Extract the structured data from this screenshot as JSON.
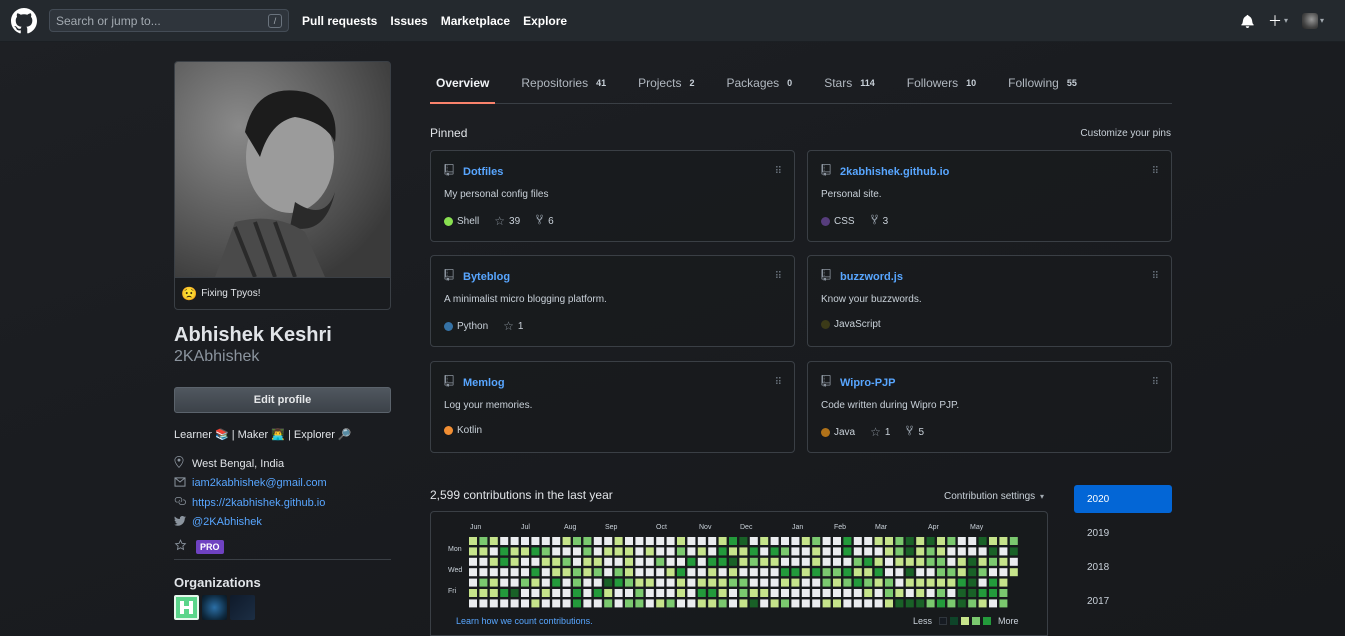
{
  "header": {
    "search_placeholder": "Search or jump to...",
    "search_shortcut": "/",
    "nav": [
      "Pull requests",
      "Issues",
      "Marketplace",
      "Explore"
    ]
  },
  "profile": {
    "status": "Fixing Tpyos!",
    "status_emoji": "😟",
    "fullname": "Abhishek Keshri",
    "username": "2KAbhishek",
    "edit_label": "Edit profile",
    "bio": "Learner 📚 | Maker 👨‍💻 | Explorer 🔎",
    "location": "West Bengal, India",
    "email": "iam2kabhishek@gmail.com",
    "website": "https://2kabhishek.github.io",
    "twitter": "@2KAbhishek",
    "pro_badge": "PRO",
    "orgs_title": "Organizations"
  },
  "tabs": [
    {
      "label": "Overview",
      "count": ""
    },
    {
      "label": "Repositories",
      "count": "41"
    },
    {
      "label": "Projects",
      "count": "2"
    },
    {
      "label": "Packages",
      "count": "0"
    },
    {
      "label": "Stars",
      "count": "114"
    },
    {
      "label": "Followers",
      "count": "10"
    },
    {
      "label": "Following",
      "count": "55"
    }
  ],
  "pinned": {
    "title": "Pinned",
    "customize": "Customize your pins",
    "repos": [
      {
        "name": "Dotfiles",
        "desc": "My personal config files",
        "lang": "Shell",
        "lang_color": "#89e051",
        "stars": "39",
        "forks": "6"
      },
      {
        "name": "2kabhishek.github.io",
        "desc": "Personal site.",
        "lang": "CSS",
        "lang_color": "#563d7c",
        "stars": "",
        "forks": "3"
      },
      {
        "name": "Byteblog",
        "desc": "A minimalist micro blogging platform.",
        "lang": "Python",
        "lang_color": "#3572A5",
        "stars": "1",
        "forks": ""
      },
      {
        "name": "buzzword.js",
        "desc": "Know your buzzwords.",
        "lang": "JavaScript",
        "lang_color": "#3b3a18",
        "stars": "",
        "forks": ""
      },
      {
        "name": "Memlog",
        "desc": "Log your memories.",
        "lang": "Kotlin",
        "lang_color": "#F18E33",
        "stars": "",
        "forks": ""
      },
      {
        "name": "Wipro-PJP",
        "desc": "Code written during Wipro PJP.",
        "lang": "Java",
        "lang_color": "#b07219",
        "stars": "1",
        "forks": "5"
      }
    ]
  },
  "contributions": {
    "title": "2,599 contributions in the last year",
    "settings": "Contribution settings",
    "months": [
      "Jun",
      "Jul",
      "Aug",
      "Sep",
      "Oct",
      "Nov",
      "Dec",
      "Jan",
      "Feb",
      "Mar",
      "Apr",
      "May"
    ],
    "days": [
      "Mon",
      "Wed",
      "Fri"
    ],
    "learn": "Learn how we count contributions.",
    "less": "Less",
    "more": "More",
    "colors": [
      "#ebedf0",
      "#c6e48b",
      "#7bc96f",
      "#239a3b",
      "#196127"
    ]
  },
  "years": [
    "2020",
    "2019",
    "2018",
    "2017"
  ]
}
